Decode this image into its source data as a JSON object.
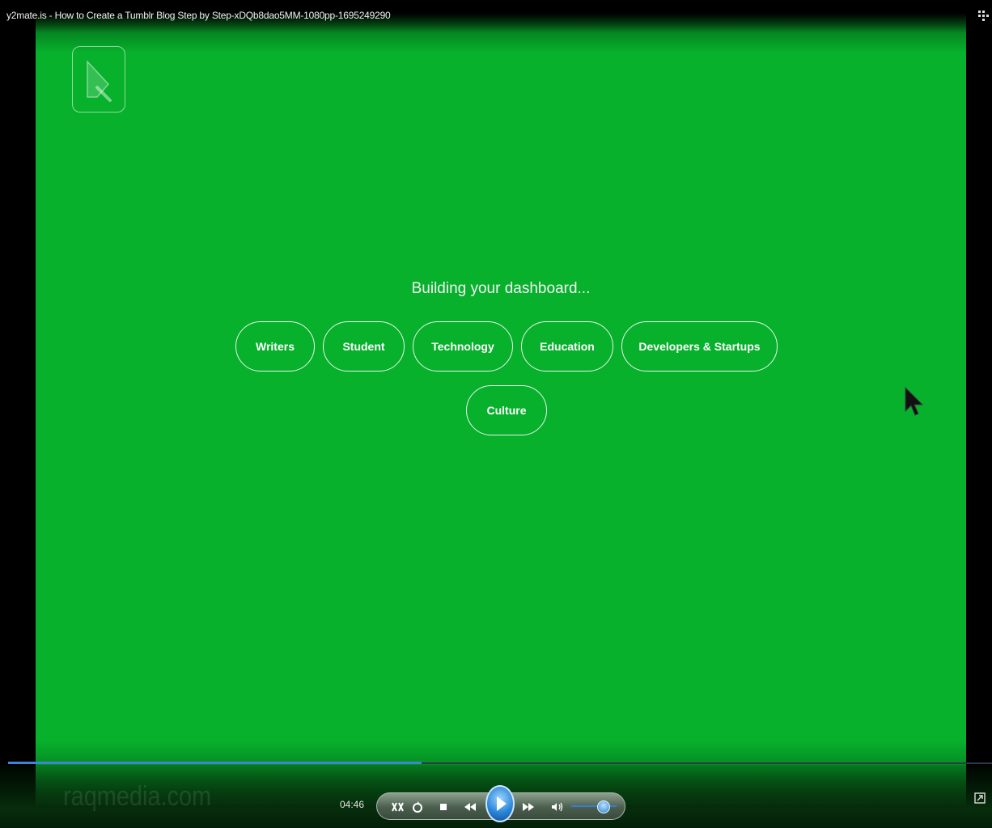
{
  "window": {
    "title": "y2mate.is - How to Create a Tumblr Blog Step by Step-xDQb8dao5MM-1080pp-1695249290"
  },
  "video": {
    "headline": "Building your dashboard...",
    "topics": [
      "Writers",
      "Student",
      "Technology",
      "Education",
      "Developers & Startups",
      "Culture"
    ],
    "background_color": "#07b12c"
  },
  "player": {
    "watermark": "raqmedia.com",
    "current_time": "04:46",
    "progress_fraction": 0.42,
    "volume_fraction": 0.7,
    "accent_color": "#3b86d8"
  }
}
